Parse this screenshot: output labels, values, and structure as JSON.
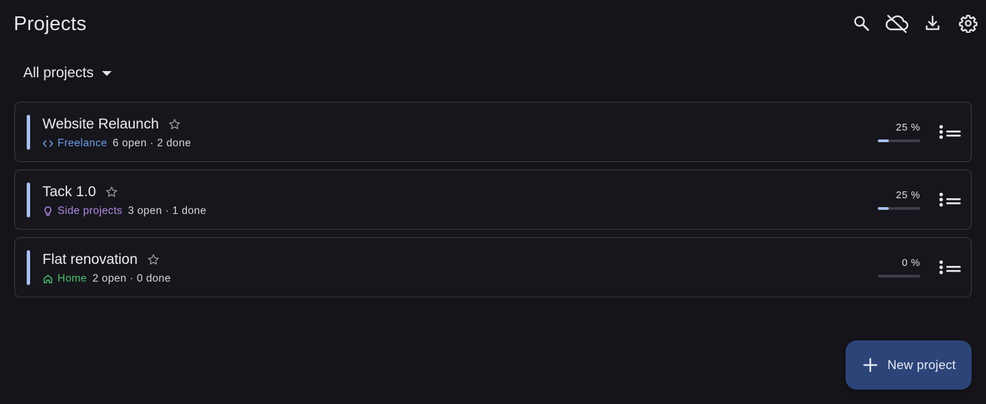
{
  "header": {
    "title": "Projects",
    "actions": [
      {
        "name": "search",
        "icon": "search-icon"
      },
      {
        "name": "sync",
        "icon": "cloud-off-icon"
      },
      {
        "name": "download",
        "icon": "download-icon"
      },
      {
        "name": "settings",
        "icon": "gear-icon"
      }
    ]
  },
  "filter": {
    "selected": "All projects"
  },
  "projects": [
    {
      "title": "Website Relaunch",
      "category": "Freelance",
      "category_icon": "code-icon",
      "category_color": "#6f9de8",
      "stats": "6 open · 2 done",
      "progress_label": "25 %",
      "progress": 0.25,
      "accent_color": "#a9c0f0"
    },
    {
      "title": "Tack 1.0",
      "category": "Side projects",
      "category_icon": "lightbulb-icon",
      "category_color": "#b389e6",
      "stats": "3 open · 1 done",
      "progress_label": "25 %",
      "progress": 0.25,
      "accent_color": "#a9c0f0"
    },
    {
      "title": "Flat renovation",
      "category": "Home",
      "category_icon": "home-icon",
      "category_color": "#4bbf6b",
      "stats": "2 open · 0 done",
      "progress_label": "0 %",
      "progress": 0,
      "accent_color": "#a9c0f0"
    }
  ],
  "fab": {
    "label": "New project",
    "icon": "plus-icon"
  },
  "colors": {
    "background": "#14141a",
    "card_border": "#3c3c46",
    "accent": "#a9c0f0",
    "fab_background": "#2d4479"
  }
}
